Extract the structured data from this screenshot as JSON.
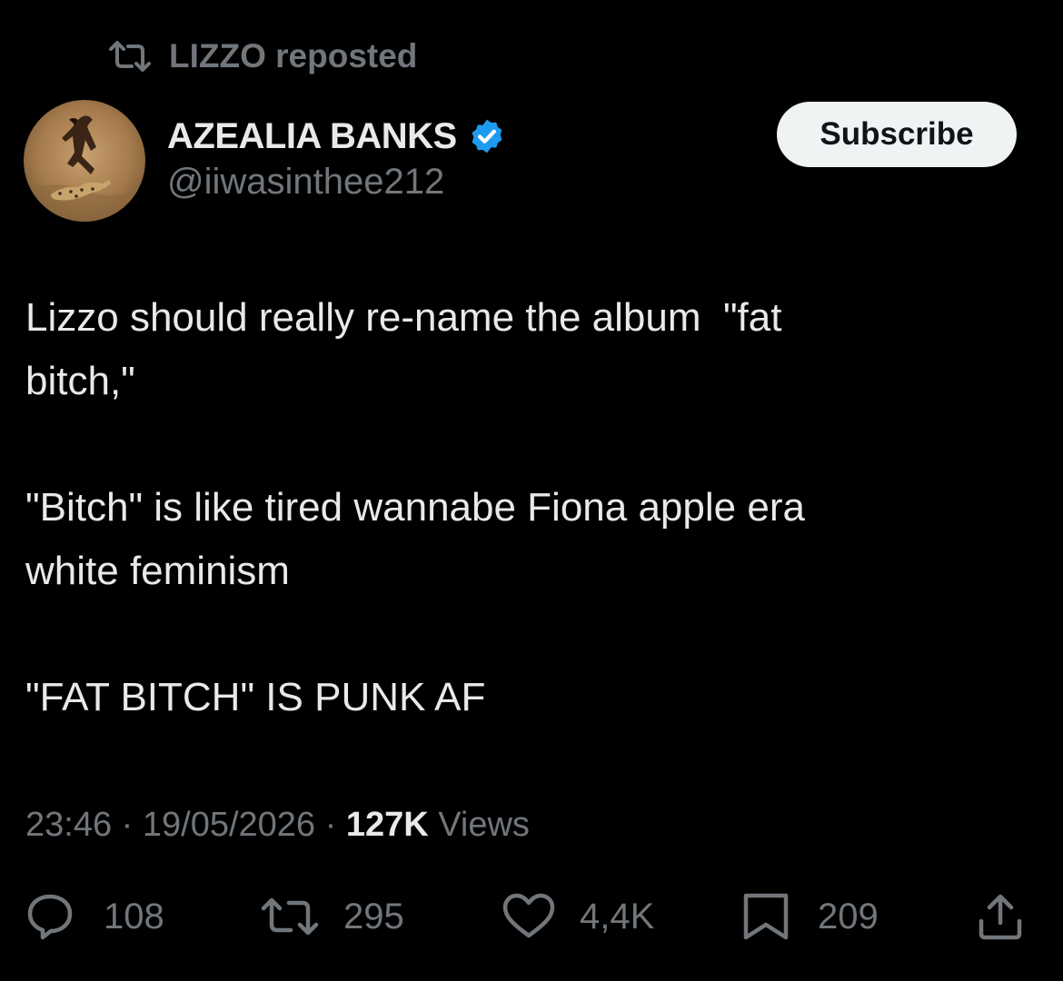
{
  "repost": {
    "icon": "repost-icon",
    "label": "LIZZO reposted"
  },
  "author": {
    "avatar": "avatar-image",
    "display_name": "AZEALIA BANKS",
    "verified_icon": "verified-badge-icon",
    "handle": "@iiwasinthee212"
  },
  "subscribe_label": "Subscribe",
  "tweet": {
    "lines": [
      "Lizzo should really re-name the album  \"fat",
      "bitch,\"",
      "\"Bitch\" is like tired wannabe Fiona apple era",
      "white feminism",
      "\"FAT BITCH\" IS PUNK AF"
    ]
  },
  "meta": {
    "time": "23:46",
    "separator": "·",
    "date": "19/05/2026",
    "views_count": "127K",
    "views_label": "Views"
  },
  "actions": {
    "replies": {
      "icon": "reply-icon",
      "count": "108"
    },
    "reposts": {
      "icon": "repost-icon",
      "count": "295"
    },
    "likes": {
      "icon": "heart-icon",
      "count": "4,4K"
    },
    "bookmarks": {
      "icon": "bookmark-icon",
      "count": "209"
    },
    "share": {
      "icon": "share-icon"
    }
  },
  "colors": {
    "background": "#000000",
    "text_primary": "#e7e9ea",
    "text_secondary": "#71767b",
    "verified_blue": "#1d9bf0",
    "button_bg": "#eff3f4"
  }
}
